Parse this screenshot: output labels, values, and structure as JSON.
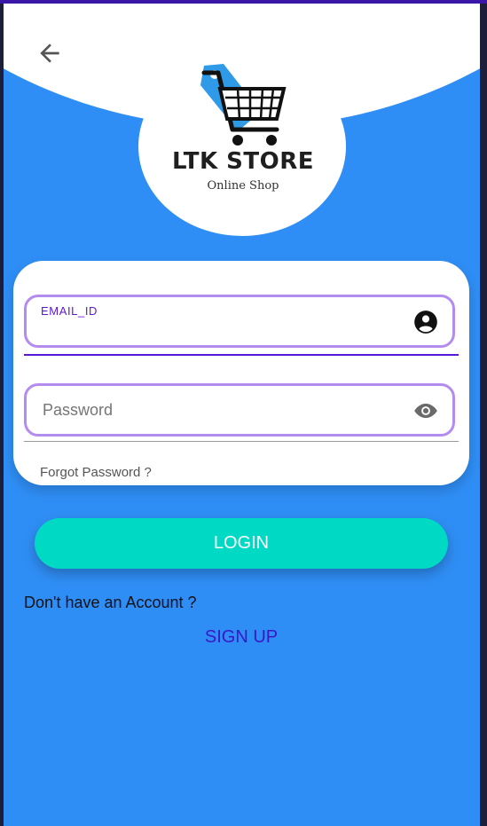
{
  "app": {
    "brand_name": "LTK STORE",
    "tagline": "Online Shop"
  },
  "login_form": {
    "email_label": "EMAIL_ID",
    "email_value": "",
    "password_placeholder": "Password",
    "forgot_password": "Forgot Password ?"
  },
  "actions": {
    "login_label": "LOGIN",
    "no_account_text": "Don't have an Account ?",
    "signup_label": "SIGN UP"
  },
  "colors": {
    "background": "#2f8ef5",
    "accent": "#00d9c4",
    "field_border": "#b48cf0",
    "link": "#3a17c7"
  },
  "icons": [
    "back-arrow-icon",
    "account-circle-icon",
    "eye-icon",
    "shopping-cart-icon",
    "price-tag-icon"
  ]
}
